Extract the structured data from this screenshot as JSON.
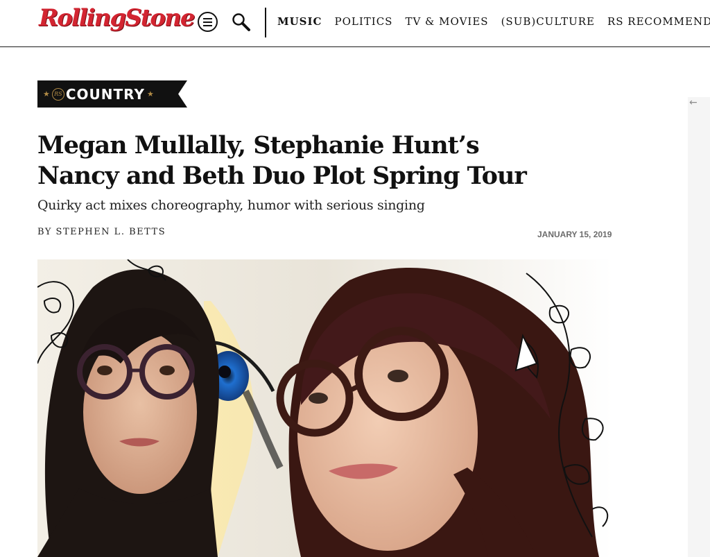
{
  "header": {
    "logo_text": "RollingStone",
    "nav": [
      {
        "label": "MUSIC",
        "active": true
      },
      {
        "label": "POLITICS",
        "active": false
      },
      {
        "label": "TV & MOVIES",
        "active": false
      },
      {
        "label": "(SUB)CULTURE",
        "active": false
      },
      {
        "label": "RS RECOMMENDS",
        "active": false
      }
    ],
    "icons": [
      "menu-icon",
      "search-icon"
    ]
  },
  "article": {
    "category": "COUNTRY",
    "category_seal": "RS",
    "title": "Megan Mullally, Stephanie Hunt’s Nancy and Beth Duo Plot Spring Tour",
    "subtitle": "Quirky act mixes choreography, humor with serious singing",
    "byline": "BY STEPHEN L. BETTS",
    "date": "JANUARY 15, 2019"
  },
  "rail": {
    "icon": "arrow-left-icon",
    "arrow_glyph": "←"
  },
  "colors": {
    "brand_red": "#d32531",
    "badge_bg": "#111111",
    "badge_gold": "#b08a45",
    "date_gray": "#6b6b6b",
    "rail_bg": "#f5f5f5"
  }
}
